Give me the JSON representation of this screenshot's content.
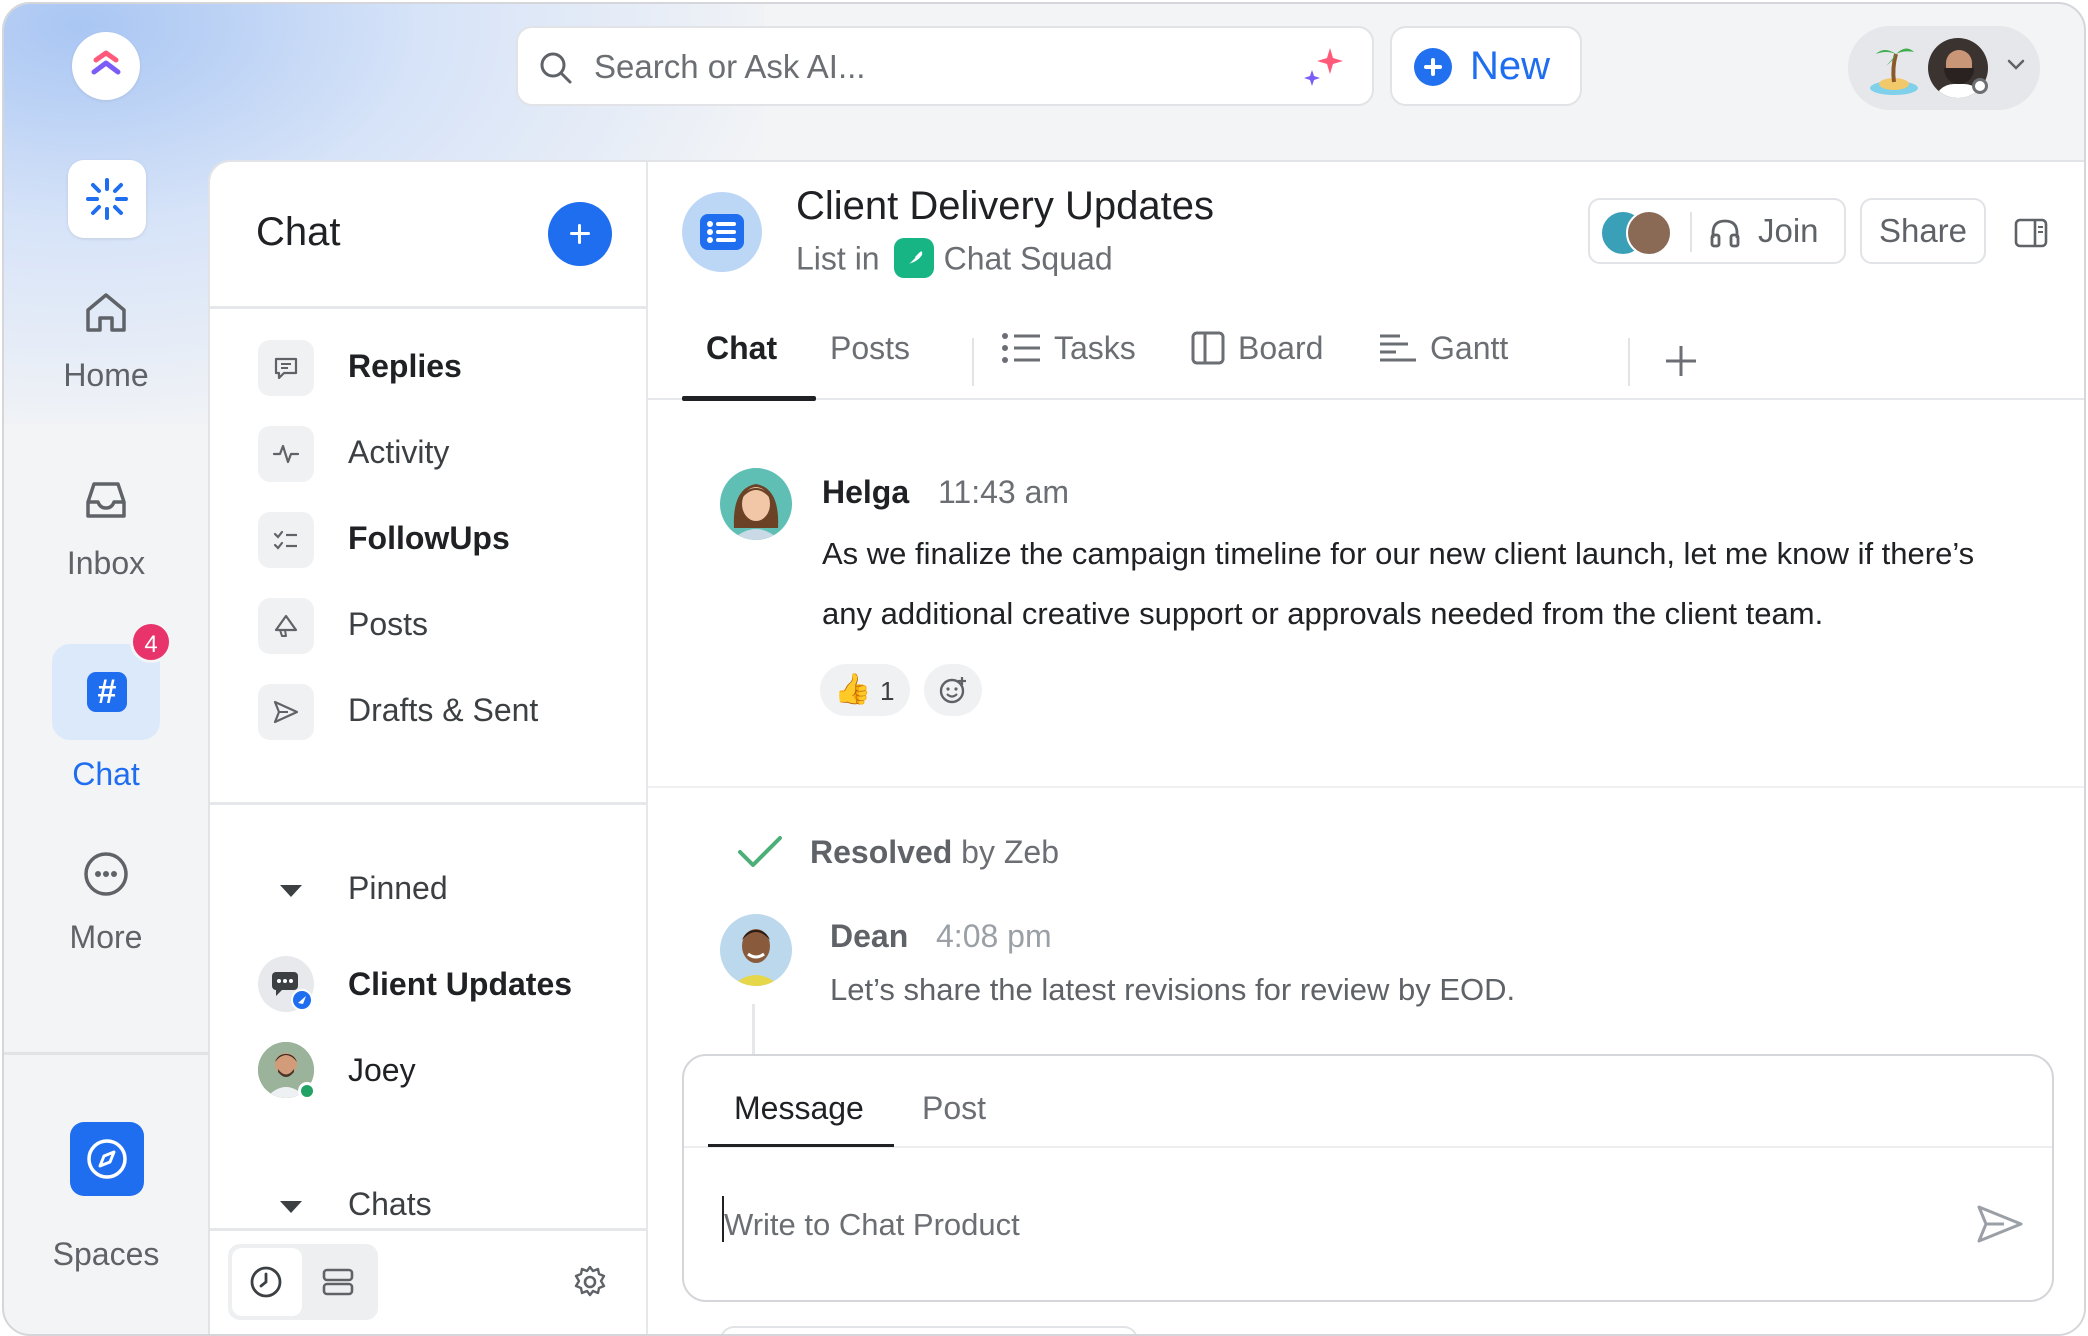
{
  "topbar": {
    "search_placeholder": "Search or Ask AI...",
    "new_label": "New"
  },
  "rail": {
    "home": "Home",
    "inbox": "Inbox",
    "chat": "Chat",
    "chat_badge": "4",
    "more": "More",
    "spaces": "Spaces"
  },
  "sidebar": {
    "title": "Chat",
    "items": [
      {
        "label": "Replies",
        "icon": "reply-bubble-icon",
        "bold": true
      },
      {
        "label": "Activity",
        "icon": "pulse-icon",
        "bold": false
      },
      {
        "label": "FollowUps",
        "icon": "checklist-icon",
        "bold": true
      },
      {
        "label": "Posts",
        "icon": "megaphone-icon",
        "bold": false
      },
      {
        "label": "Drafts & Sent",
        "icon": "send-icon",
        "bold": false
      }
    ],
    "pinned_label": "Pinned",
    "pinned": [
      {
        "label": "Client Updates"
      },
      {
        "label": "Joey"
      }
    ],
    "chats_label": "Chats"
  },
  "channel": {
    "title": "Client Delivery Updates",
    "sub_prefix": "List in",
    "space": "Chat Squad",
    "join": "Join",
    "share": "Share"
  },
  "tabs": {
    "chat": "Chat",
    "posts": "Posts",
    "tasks": "Tasks",
    "board": "Board",
    "gantt": "Gantt"
  },
  "messages": [
    {
      "author": "Helga",
      "time": "11:43 am",
      "line1": "As we finalize the campaign timeline for our new client launch, let me know if there’s",
      "line2": "any additional creative support or approvals needed from the client team.",
      "reaction_emoji": "👍",
      "reaction_count": "1"
    },
    {
      "author": "Dean",
      "time": "4:08 pm",
      "text": "Let’s share the latest revisions for review by EOD."
    }
  ],
  "resolved": {
    "label": "Resolved",
    "by": "by Zeb"
  },
  "composer": {
    "tab_message": "Message",
    "tab_post": "Post",
    "placeholder": "Write to Chat Product"
  },
  "colors": {
    "accent": "#1f6ef0",
    "badge": "#e8336b",
    "resolved_check": "#4caf78",
    "space_green": "#17b584"
  }
}
